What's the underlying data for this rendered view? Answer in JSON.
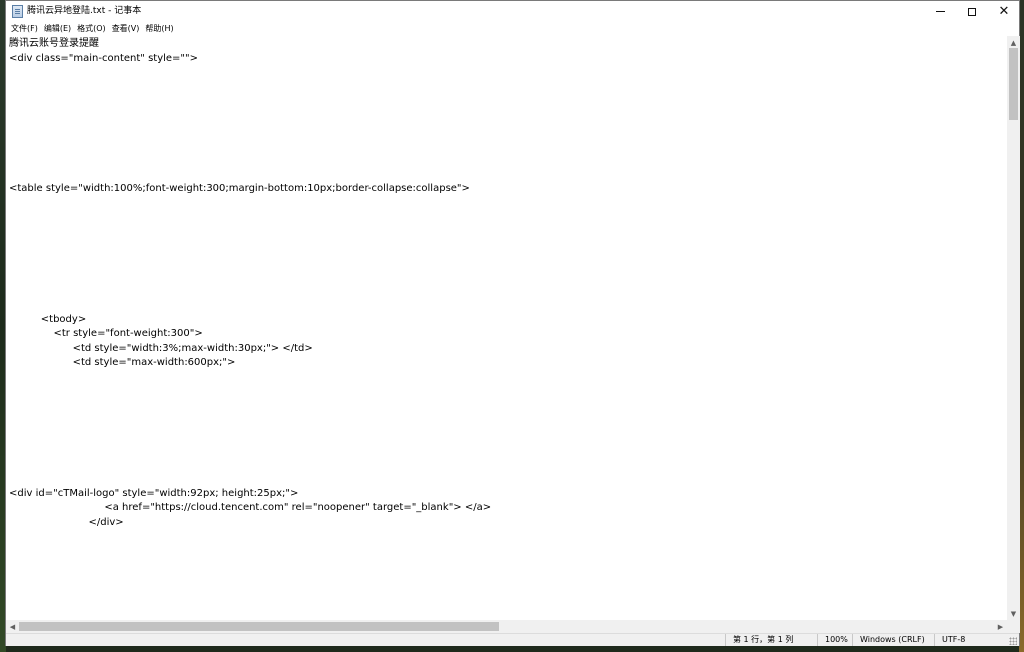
{
  "window": {
    "title": "腾讯云异地登陆.txt - 记事本",
    "minimize_symbol": "—",
    "close_symbol": "✕"
  },
  "menu": [
    {
      "label": "文件(F)"
    },
    {
      "label": "编辑(E)"
    },
    {
      "label": "格式(O)"
    },
    {
      "label": "查看(V)"
    },
    {
      "label": "帮助(H)"
    }
  ],
  "document": {
    "text": "腾讯云账号登录提醒\n<div class=\"main-content\" style=\"\">\n\n\n\n\n\n\n\n\n<table style=\"width:100%;font-weight:300;margin-bottom:10px;border-collapse:collapse\">\n\n\n\n\n\n\n\n\n          <tbody>\n              <tr style=\"font-weight:300\">\n                    <td style=\"width:3%;max-width:30px;\"> </td>\n                    <td style=\"max-width:600px;\">\n\n\n\n\n\n\n\n\n<div id=\"cTMail-logo\" style=\"width:92px; height:25px;\">\n                              <a href=\"https://cloud.tencent.com\" rel=\"noopener\" target=\"_blank\"> </a>\n                         </div>"
  },
  "status": {
    "position": "第 1 行，第 1 列",
    "zoom": "100%",
    "line_ending": "Windows (CRLF)",
    "encoding": "UTF-8"
  },
  "icons": {
    "app": "notepad-icon",
    "scroll_up": "▲",
    "scroll_down": "▼",
    "scroll_left": "◀",
    "scroll_right": "▶"
  }
}
